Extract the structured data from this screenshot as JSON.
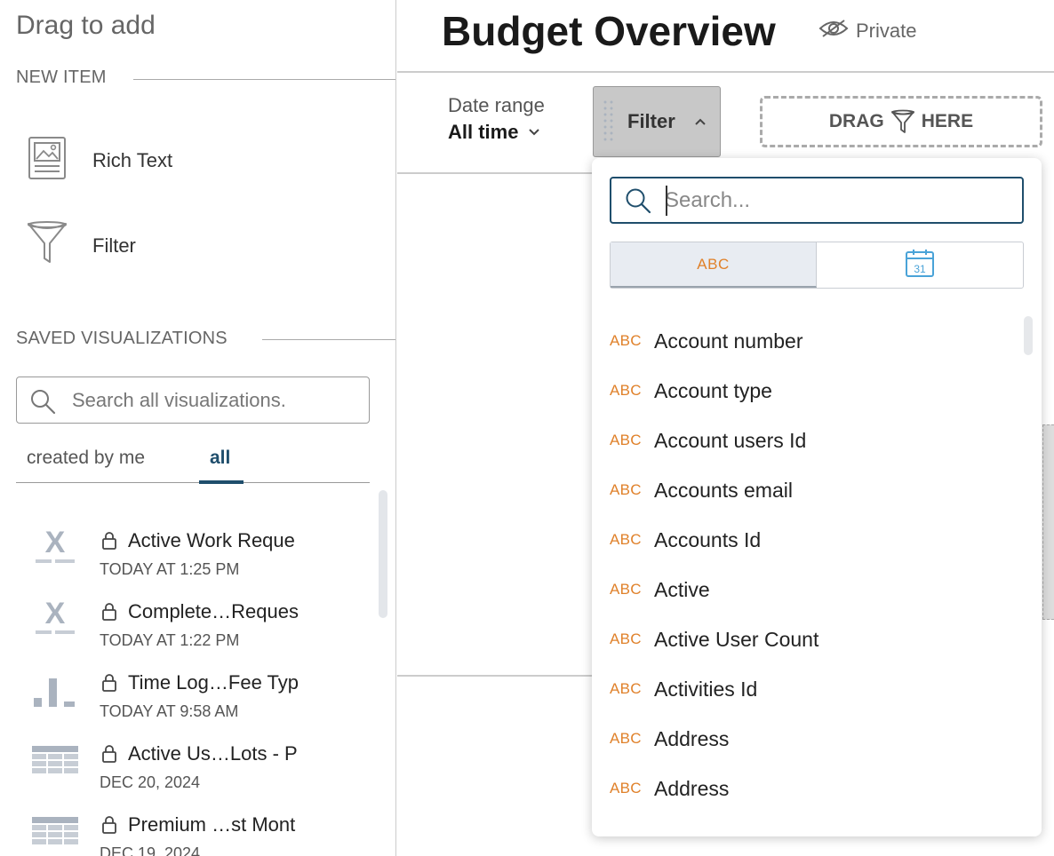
{
  "sidebar": {
    "title": "Drag to add",
    "new_item_heading": "NEW ITEM",
    "new_items": [
      {
        "label": "Rich Text",
        "icon": "rich-text-icon"
      },
      {
        "label": "Filter",
        "icon": "funnel-icon"
      }
    ],
    "saved_heading": "SAVED VISUALIZATIONS",
    "search_placeholder": "Search all visualizations.",
    "tabs": [
      {
        "label": "created by me",
        "active": false
      },
      {
        "label": "all",
        "active": true
      }
    ],
    "visualizations": [
      {
        "name": "Active Work Reque",
        "date": "TODAY AT 1:25 PM",
        "icon": "x-chart-icon"
      },
      {
        "name": "Complete…Reques",
        "date": "TODAY AT 1:22 PM",
        "icon": "x-chart-icon"
      },
      {
        "name": "Time Log…Fee Typ",
        "date": "TODAY AT 9:58 AM",
        "icon": "bar-chart-icon"
      },
      {
        "name": "Active Us…Lots - P",
        "date": "DEC 20, 2024",
        "icon": "table-icon"
      },
      {
        "name": "Premium …st Mont",
        "date": "DEC 19, 2024",
        "icon": "table-icon"
      }
    ]
  },
  "main": {
    "title": "Budget Overview",
    "visibility": "Private",
    "date_range_label": "Date range",
    "date_range_value": "All time",
    "filter_button": "Filter",
    "drag_here_left": "DRAG",
    "drag_here_right": "HERE"
  },
  "filter_dropdown": {
    "search_placeholder": "Search...",
    "type_tabs": [
      {
        "label": "ABC",
        "active": true
      },
      {
        "label": "31",
        "icon": "calendar-icon",
        "active": false
      }
    ],
    "type_badge": "ABC",
    "fields": [
      "Account number",
      "Account type",
      "Account users Id",
      "Accounts email",
      "Accounts Id",
      "Active",
      "Active User Count",
      "Activities Id",
      "Address",
      "Address"
    ]
  },
  "colors": {
    "accent": "#1f4e6c",
    "abc_orange": "#e0812a",
    "calendar_blue": "#4aa3d8"
  }
}
